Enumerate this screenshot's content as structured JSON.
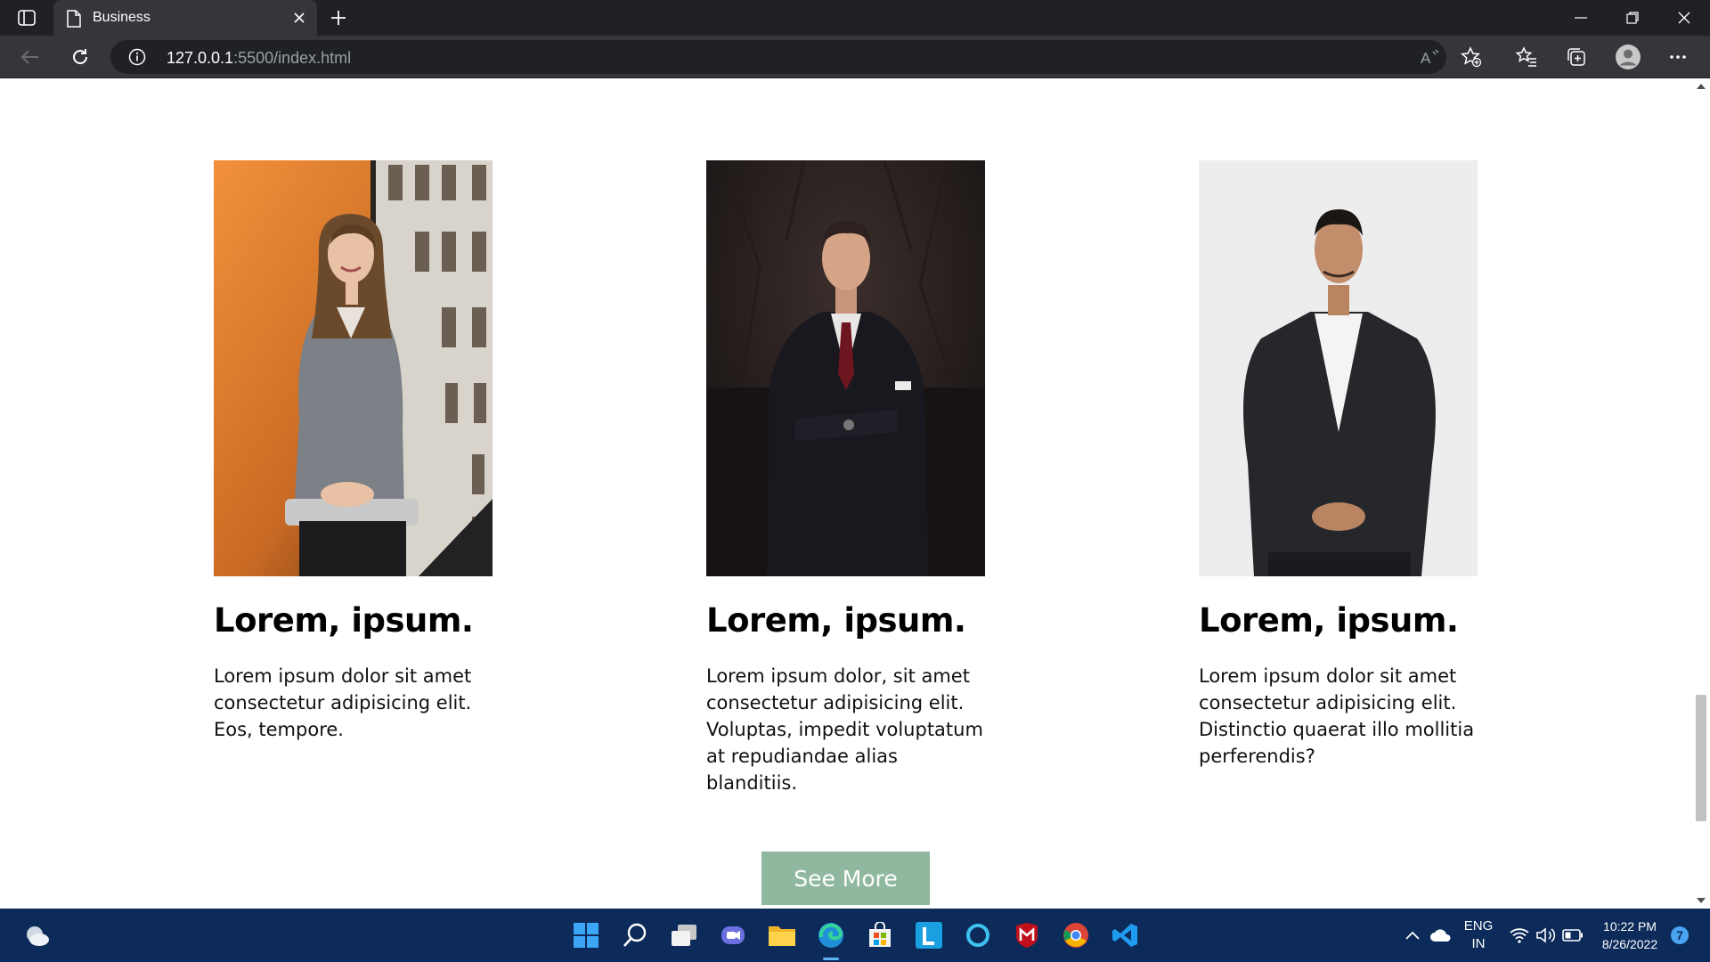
{
  "browser": {
    "tab_title": "Business",
    "address_host": "127.0.0.1",
    "address_path": ":5500/index.html"
  },
  "cards": [
    {
      "title": "Lorem, ipsum.",
      "text": "Lorem ipsum dolor sit amet consectetur adipisicing elit. Eos, tempore."
    },
    {
      "title": "Lorem, ipsum.",
      "text": "Lorem ipsum dolor, sit amet consectetur adipisicing elit. Voluptas, impedit voluptatum at repudiandae alias blanditiis."
    },
    {
      "title": "Lorem, ipsum.",
      "text": "Lorem ipsum dolor sit amet consectetur adipisicing elit. Distinctio quaerat illo mollitia perferendis?"
    }
  ],
  "see_more_label": "See More",
  "taskbar": {
    "language_top": "ENG",
    "language_bottom": "IN",
    "time": "10:22 PM",
    "date": "8/26/2022",
    "notification_count": "7"
  },
  "colors": {
    "accent_button": "#8fb89f",
    "taskbar": "#0c2a5a",
    "chrome": "#35363a"
  }
}
